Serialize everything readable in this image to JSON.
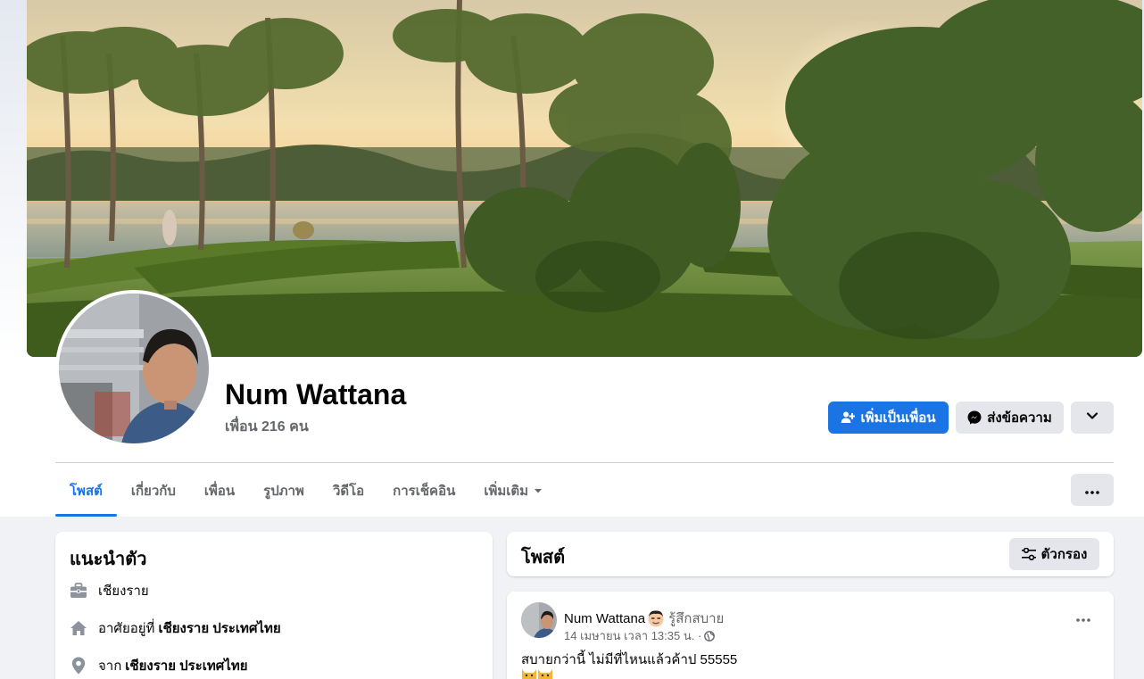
{
  "profile": {
    "name": "Num Wattana",
    "friends_text": "เพื่อน 216 คน"
  },
  "actions": {
    "add_friend_label": "เพิ่มเป็นเพื่อน",
    "message_label": "ส่งข้อความ"
  },
  "tabs": [
    {
      "label": "โพสต์",
      "active": true
    },
    {
      "label": "เกี่ยวกับ",
      "active": false
    },
    {
      "label": "เพื่อน",
      "active": false
    },
    {
      "label": "รูปภาพ",
      "active": false
    },
    {
      "label": "วิดีโอ",
      "active": false
    },
    {
      "label": "การเช็คอิน",
      "active": false
    },
    {
      "label": "เพิ่มเติม",
      "active": false
    }
  ],
  "intro": {
    "title": "แนะนำตัว",
    "work": "เชียงราย",
    "lives_prefix": "อาศัยอยู่ที่",
    "lives_place": "เชียงราย ประเทศไทย",
    "from_prefix": "จาก",
    "from_place": "เชียงราย ประเทศไทย"
  },
  "posts": {
    "title": "โพสต์",
    "filter_label": "ตัวกรอง",
    "items": [
      {
        "author": "Num Wattana",
        "feeling": "รู้สึกสบาย",
        "timestamp": "14 เมษายน เวลา 13:35 น. ·",
        "text": "สบายกว่านี้ ไม่มีที่ไหนแล้วค้าป 55555"
      }
    ]
  },
  "colors": {
    "accent": "#1b74e4",
    "secondary_button": "#e4e6eb",
    "background": "#f0f2f5",
    "muted_text": "#65676b"
  },
  "icons": {
    "add_friend": "person-add-icon",
    "message": "messenger-icon",
    "more": "chevron-down-icon",
    "overflow": "ellipsis-icon",
    "filter": "filter-icon",
    "work": "briefcase-icon",
    "home": "home-icon",
    "location": "location-pin-icon",
    "privacy": "globe-icon"
  }
}
